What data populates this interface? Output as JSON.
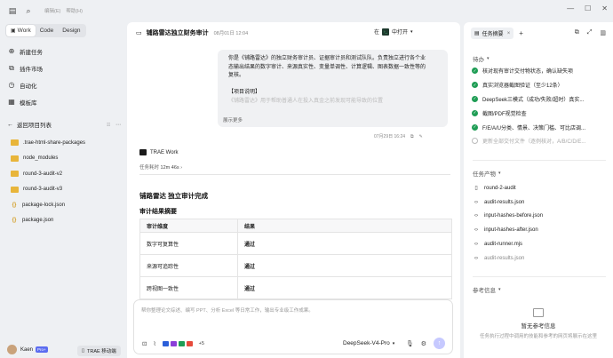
{
  "topbar": {
    "menus": [
      "编辑(E)",
      "帮助(H)"
    ]
  },
  "sidebar": {
    "modes": [
      "Work",
      "Code",
      "Design"
    ],
    "nav": [
      {
        "label": "新建任务",
        "icon": "new-task-icon"
      },
      {
        "label": "插件市场",
        "icon": "plugin-icon"
      },
      {
        "label": "自动化",
        "icon": "automation-icon"
      },
      {
        "label": "模板库",
        "icon": "template-icon"
      }
    ],
    "project_header": "返回项目列表",
    "files": [
      {
        "name": ".trae-html-share-packages",
        "type": "folder"
      },
      {
        "name": "node_modules",
        "type": "folder"
      },
      {
        "name": "round-3-audit-v2",
        "type": "folder"
      },
      {
        "name": "round-3-audit-v3",
        "type": "folder"
      },
      {
        "name": "package-lock.json",
        "type": "json"
      },
      {
        "name": "package.json",
        "type": "json"
      }
    ],
    "user": {
      "name": "Kaen",
      "badge": "Pro+"
    },
    "mobile_button": "TRAE 移动端"
  },
  "main": {
    "title": "铺路雷达独立财务审计",
    "date": "08月01日 12:04",
    "open_in": {
      "prefix": "在",
      "label": "中打开"
    },
    "user_message": {
      "lines": [
        "你是《铺路雷达》的独立财务审计员、证据审计员和测试队队。负责独立进行各个业",
        "态输出结果的数字审计、来源真实性、变量单调性、计算逻辑、图表数据一致性等的",
        "复核。",
        "",
        "【项目说明】"
      ],
      "faded_line": "《铺路雷达》用于帮助普通人在投入真金之前发现可能导致的位置",
      "show_more": "展示更多",
      "meta_time": "07月29日 16:24"
    },
    "agent_name": "TRAE Work",
    "duration_label": "任务耗时",
    "duration_value": "12m 46s",
    "heading": "铺路雷达 独立审计完成",
    "subheading": "审计结果摘要",
    "table": {
      "headers": [
        "审计维度",
        "结果"
      ],
      "rows": [
        [
          "数字可复算性",
          "通过"
        ],
        [
          "来源可追踪性",
          "通过"
        ],
        [
          "跨视图一致性",
          "通过"
        ]
      ]
    },
    "composer": {
      "placeholder": "帮你整理论文综述、编写 PPT、分析 Excel 等日常工作，输出专业级工作成果。",
      "more_apps": "+5",
      "model": "DeepSeek-V4-Pro"
    }
  },
  "right": {
    "tab_label": "任务摘要",
    "todo_title": "待办",
    "todos": [
      {
        "label": "核对现有审计交付物状态，确认缺失项",
        "done": true
      },
      {
        "label": "真实浏览器截图验证（至少12条）",
        "done": true
      },
      {
        "label": "DeepSeek三模式（成功/失败/超时）真实...",
        "done": true
      },
      {
        "label": "截图/PDF视觉检查",
        "done": true
      },
      {
        "label": "F/E/A/U分类、情景、决策门槛、可比店调...",
        "done": true
      },
      {
        "label": "更新全部交付文件（逐例核对，A/B/C/D/E...",
        "done": false
      }
    ],
    "artifacts_title": "任务产物",
    "artifacts": [
      {
        "name": "round-2-audit",
        "kind": "file"
      },
      {
        "name": "audit-results.json",
        "kind": "code"
      },
      {
        "name": "input-hashes-before.json",
        "kind": "code"
      },
      {
        "name": "input-hashes-after.json",
        "kind": "code"
      },
      {
        "name": "audit-runner.mjs",
        "kind": "code"
      },
      {
        "name": "audit-results.json",
        "kind": "code"
      }
    ],
    "ref_title": "参考信息",
    "ref_empty_title": "暂无参考信息",
    "ref_empty_desc": "任务执行过程中调用的技能和参考的网页将展示在这里"
  }
}
